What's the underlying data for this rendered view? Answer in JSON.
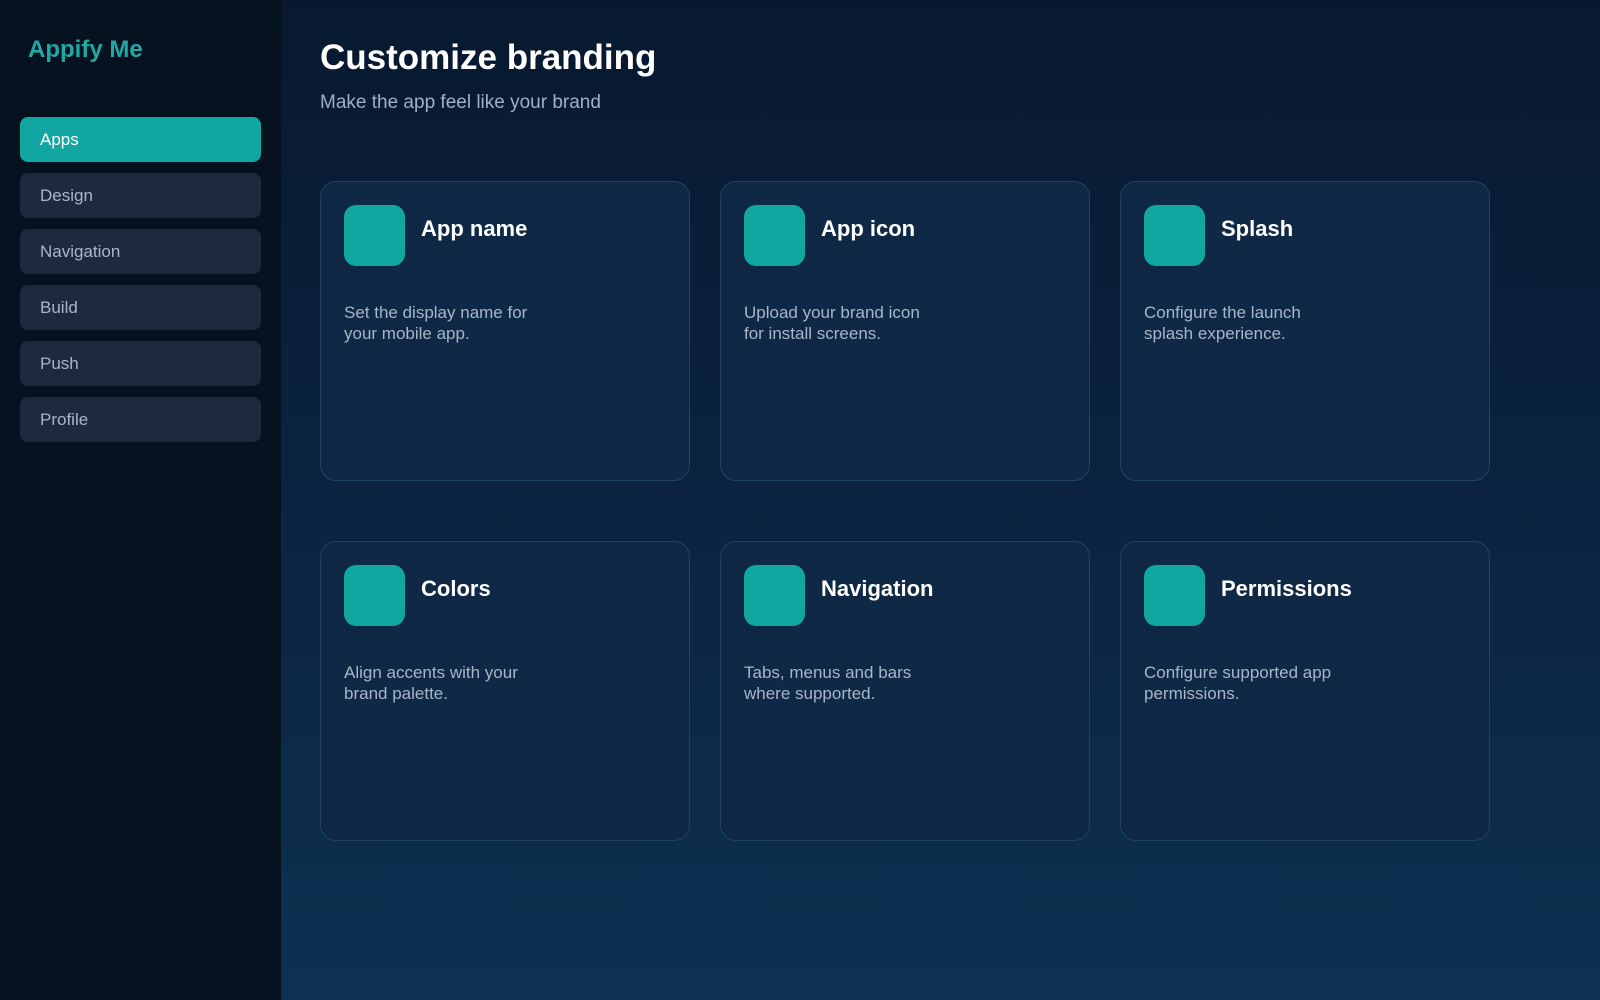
{
  "app": {
    "brand": "Appify Me"
  },
  "sidebar": {
    "items": [
      {
        "label": "Apps",
        "active": true
      },
      {
        "label": "Design",
        "active": false
      },
      {
        "label": "Navigation",
        "active": false
      },
      {
        "label": "Build",
        "active": false
      },
      {
        "label": "Push",
        "active": false
      },
      {
        "label": "Profile",
        "active": false
      }
    ]
  },
  "main": {
    "title": "Customize branding",
    "subtitle": "Make the app feel like your brand",
    "cards": [
      {
        "title": "App name",
        "description": "Set the display name for your mobile app."
      },
      {
        "title": "App icon",
        "description": "Upload your brand icon for install screens."
      },
      {
        "title": "Splash",
        "description": "Configure the launch splash experience."
      },
      {
        "title": "Colors",
        "description": "Align accents with your brand palette."
      },
      {
        "title": "Navigation",
        "description": "Tabs, menus and bars where supported."
      },
      {
        "title": "Permissions",
        "description": "Configure supported app permissions."
      }
    ]
  },
  "colors": {
    "accent": "#12a6a0",
    "sidebar_bg": "#071221",
    "card_bg": "#0f2845"
  }
}
